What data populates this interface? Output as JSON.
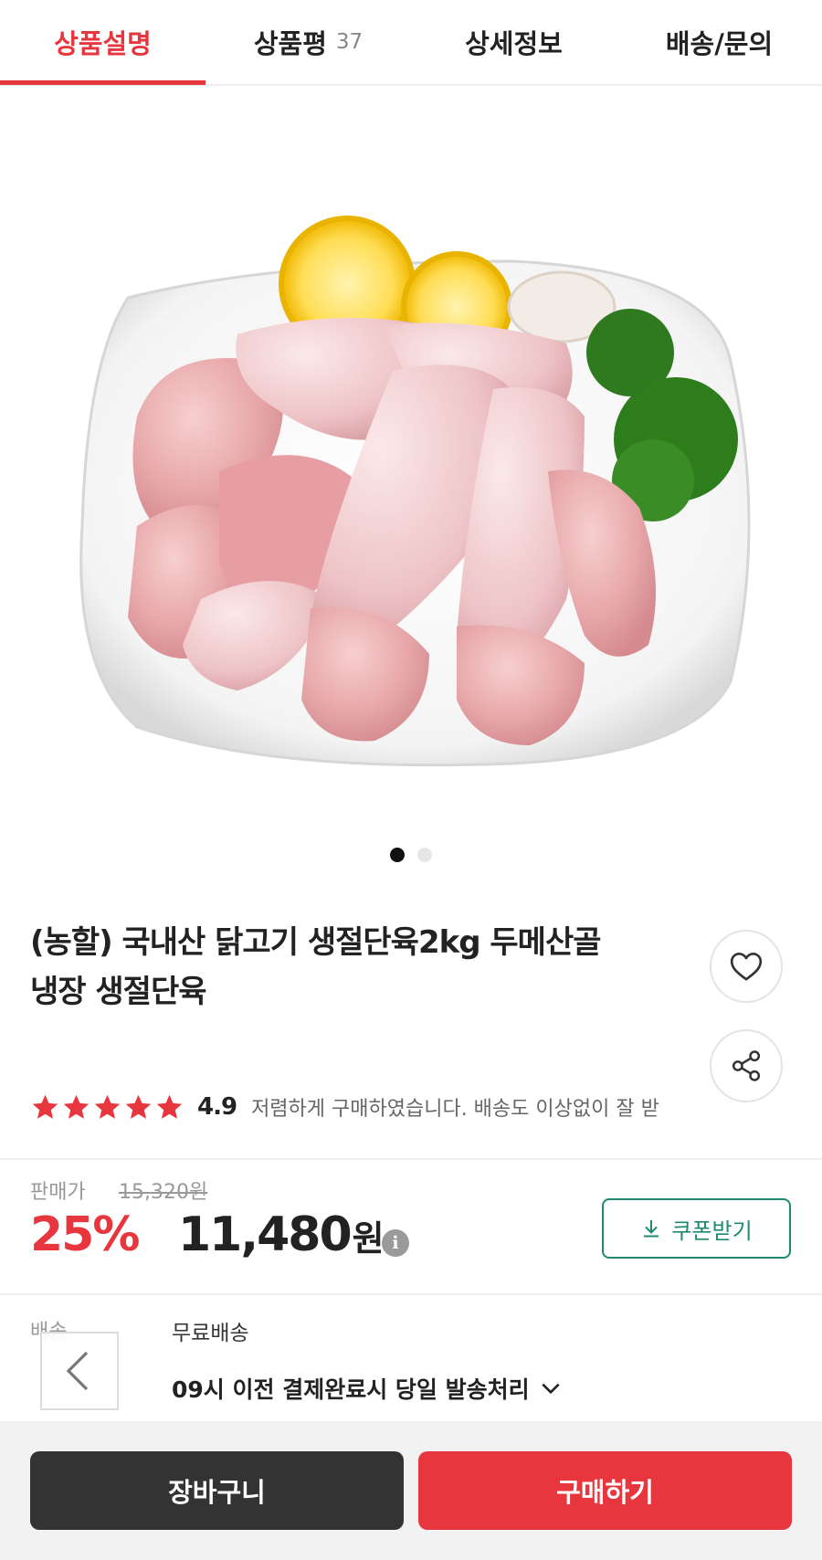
{
  "tabs": [
    {
      "label": "상품설명",
      "active": true
    },
    {
      "label": "상품평",
      "count": "37"
    },
    {
      "label": "상세정보"
    },
    {
      "label": "배송/문의"
    }
  ],
  "gallery": {
    "image": "raw-chicken-pieces-on-plate",
    "total": 2,
    "current": 1
  },
  "product": {
    "title_line1": "(농할) 국내산 닭고기 생절단육2kg 두메산골",
    "title_line2": "냉장 생절단육"
  },
  "rating": {
    "stars": 5,
    "score": "4.9",
    "review_snippet": "저렴하게 구매하였습니다. 배송도 이상없이 잘 받"
  },
  "price": {
    "label": "판매가",
    "original": "15,320원",
    "discount": "25%",
    "sale_amount": "11,480",
    "sale_unit": "원",
    "info_symbol": "i"
  },
  "coupon": {
    "label": "쿠폰받기"
  },
  "shipping": {
    "label": "배송",
    "type": "무료배송",
    "note": "09시 이전 결제완료시 당일 발송처리"
  },
  "actions": {
    "cart": "장바구니",
    "buy": "구매하기"
  },
  "colors": {
    "accent": "#e8363f",
    "coupon": "#1f8a6e",
    "dark": "#333333"
  }
}
